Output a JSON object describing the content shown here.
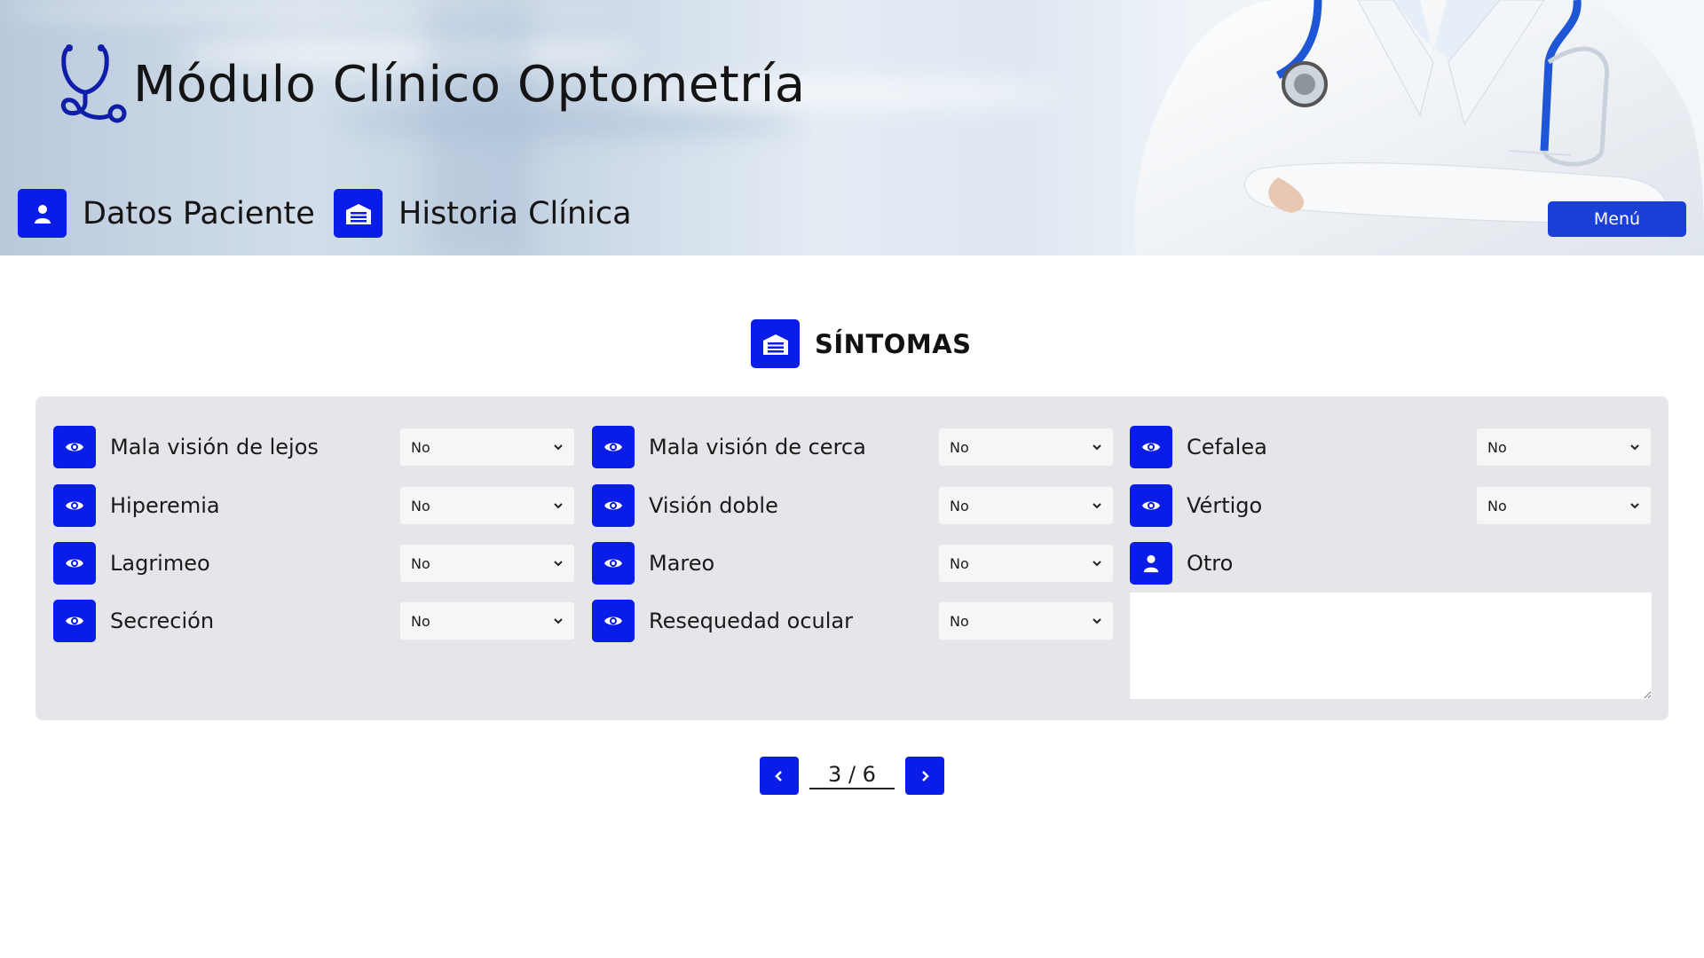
{
  "app": {
    "title": "Módulo Clínico Optometría"
  },
  "nav": [
    {
      "label": "Datos Paciente",
      "icon": "user-icon"
    },
    {
      "label": "Historia Clínica",
      "icon": "clinic-icon"
    }
  ],
  "menu_label": "Menú",
  "section": {
    "title": "SÍNTOMAS",
    "icon": "clinic-icon"
  },
  "symptoms": {
    "mala_vision_lejos": {
      "label": "Mala visión de lejos",
      "value": "No"
    },
    "hiperemia": {
      "label": "Hiperemia",
      "value": "No"
    },
    "lagrimeo": {
      "label": "Lagrimeo",
      "value": "No"
    },
    "secrecion": {
      "label": "Secreción",
      "value": "No"
    },
    "mala_vision_cerca": {
      "label": "Mala visión de cerca",
      "value": "No"
    },
    "vision_doble": {
      "label": "Visión doble",
      "value": "No"
    },
    "mareo": {
      "label": "Mareo",
      "value": "No"
    },
    "resequedad_ocular": {
      "label": "Resequedad ocular",
      "value": "No"
    },
    "cefalea": {
      "label": "Cefalea",
      "value": "No"
    },
    "vertigo": {
      "label": "Vértigo",
      "value": "No"
    },
    "otro": {
      "label": "Otro",
      "value": ""
    }
  },
  "pager": {
    "label": "3 / 6",
    "current": 3,
    "total": 6
  },
  "colors": {
    "accent": "#0a1de8",
    "menu": "#1a3fd6",
    "panel": "#e5e6ea"
  }
}
